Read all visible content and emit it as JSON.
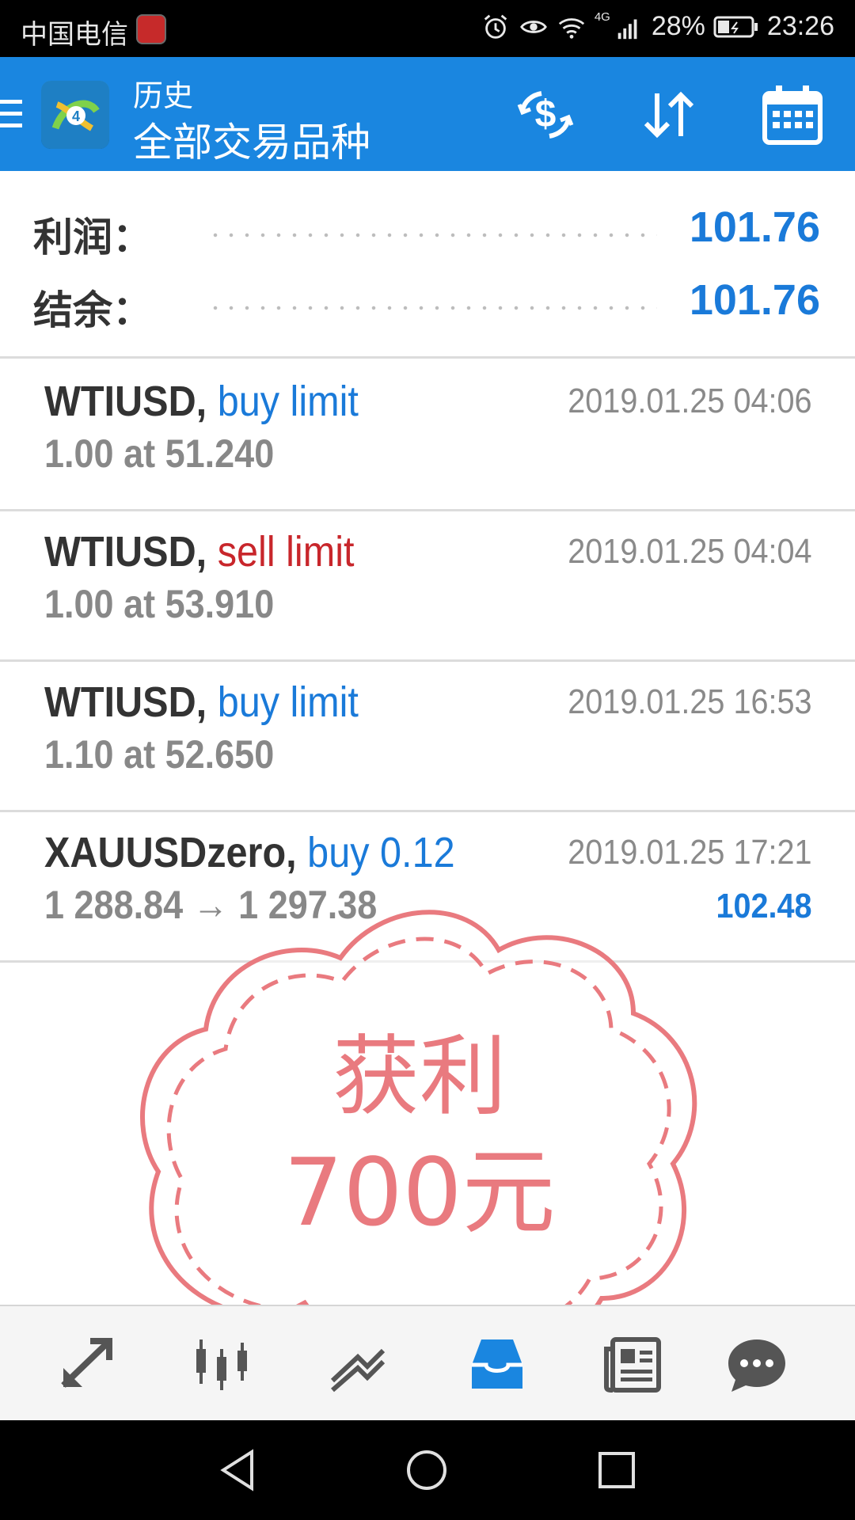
{
  "status_bar": {
    "carrier": "中国电信",
    "network": "4G",
    "battery": "28%",
    "time": "23:26"
  },
  "app_bar": {
    "title": "历史",
    "subtitle": "全部交易品种",
    "brand_color": "#1a86e0"
  },
  "summary": {
    "profit_label": "利润：",
    "profit_value": "101.76",
    "balance_label": "结余：",
    "balance_value": "101.76"
  },
  "orders": [
    {
      "symbol": "WTIUSD,",
      "type": "buy limit",
      "type_color": "blue",
      "detail": "1.00 at 51.240",
      "time": "2019.01.25 04:06",
      "profit": ""
    },
    {
      "symbol": "WTIUSD,",
      "type": "sell limit",
      "type_color": "red",
      "detail": "1.00 at 53.910",
      "time": "2019.01.25 04:04",
      "profit": ""
    },
    {
      "symbol": "WTIUSD,",
      "type": "buy limit",
      "type_color": "blue",
      "detail": "1.10 at 52.650",
      "time": "2019.01.25 16:53",
      "profit": ""
    },
    {
      "symbol": "XAUUSDzero,",
      "type": "buy 0.12",
      "type_color": "blue",
      "detail": "1 288.84 → 1 297.38",
      "time": "2019.01.25 17:21",
      "profit": "102.48"
    }
  ],
  "stamp": {
    "line1": "获利",
    "line2": "700元",
    "color": "#e97a7f"
  },
  "tabs": [
    {
      "icon": "trade-icon"
    },
    {
      "icon": "chart-icon"
    },
    {
      "icon": "analytics-icon"
    },
    {
      "icon": "history-icon",
      "active": true
    },
    {
      "icon": "news-icon"
    },
    {
      "icon": "chat-icon"
    }
  ],
  "colors": {
    "accent_blue": "#1a7ad9",
    "sell_red": "#c8262b",
    "active_tab": "#1a86e0"
  }
}
